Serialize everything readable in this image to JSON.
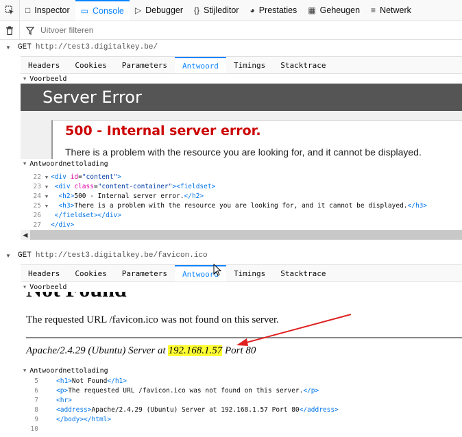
{
  "toolbar": {
    "tabs": [
      {
        "label": "Inspector",
        "icon": "inspector-icon"
      },
      {
        "label": "Console",
        "icon": "console-icon"
      },
      {
        "label": "Debugger",
        "icon": "debugger-icon"
      },
      {
        "label": "Stijleditor",
        "icon": "braces-icon"
      },
      {
        "label": "Prestaties",
        "icon": "gauge-icon"
      },
      {
        "label": "Geheugen",
        "icon": "memory-icon"
      },
      {
        "label": "Netwerk",
        "icon": "network-icon"
      }
    ]
  },
  "filter": {
    "placeholder": "Uitvoer filteren"
  },
  "requests": [
    {
      "method": "GET",
      "url": "http://test3.digitalkey.be/",
      "subtabs": [
        "Headers",
        "Cookies",
        "Parameters",
        "Antwoord",
        "Timings",
        "Stacktrace"
      ],
      "preview_label": "Voorbeeld",
      "preview": {
        "banner": "Server Error",
        "heading": "500 - Internal server error.",
        "text": "There is a problem with the resource you are looking for, and it cannot be displayed."
      },
      "payload_label": "Antwoordnettolading",
      "code_lines": [
        {
          "n": "22",
          "fold": "▼",
          "indent": "",
          "html": "div_content"
        },
        {
          "n": "23",
          "fold": "▼",
          "indent": " ",
          "html": "div_container"
        },
        {
          "n": "24",
          "fold": "▼",
          "indent": "  ",
          "html": "h2"
        },
        {
          "n": "25",
          "fold": "▼",
          "indent": "  ",
          "html": "h3"
        },
        {
          "n": "26",
          "fold": "",
          "indent": " ",
          "html": "close_fieldset"
        },
        {
          "n": "27",
          "fold": "",
          "indent": "",
          "html": "close_div"
        }
      ],
      "code_text": {
        "div_content": "<div id=\"content\">",
        "div_container": "<div class=\"content-container\"><fieldset>",
        "h2": "<h2>500 - Internal server error.</h2>",
        "h3": "<h3>There is a problem with the resource you are looking for, and it cannot be displayed.</h3>",
        "close_fieldset": "</fieldset></div>",
        "close_div": "</div>"
      }
    },
    {
      "method": "GET",
      "url": "http://test3.digitalkey.be/favicon.ico",
      "subtabs": [
        "Headers",
        "Cookies",
        "Parameters",
        "Antwoord",
        "Timings",
        "Stacktrace"
      ],
      "preview_label": "Voorbeeld",
      "preview": {
        "heading": "Not Found",
        "text": "The requested URL /favicon.ico was not found on this server.",
        "address_before": "Apache/2.4.29 (Ubuntu) Server at ",
        "address_ip": "192.168.1.57",
        "address_after": " Port 80"
      },
      "payload_label": "Antwoordnettolading",
      "code_lines": [
        {
          "n": "5",
          "text": "<h1>Not Found</h1>"
        },
        {
          "n": "6",
          "text": "<p>The requested URL /favicon.ico was not found on this server.</p>"
        },
        {
          "n": "7",
          "text": "<hr>"
        },
        {
          "n": "8",
          "text": "<address>Apache/2.4.29 (Ubuntu) Server at 192.168.1.57 Port 80</address>"
        },
        {
          "n": "9",
          "text": "</body></html>"
        },
        {
          "n": "10",
          "text": ""
        }
      ]
    }
  ],
  "colors": {
    "accent": "#0a84ff",
    "error_red": "#cc0000",
    "highlight": "#ffff33",
    "annotation_arrow": "#e02020"
  }
}
